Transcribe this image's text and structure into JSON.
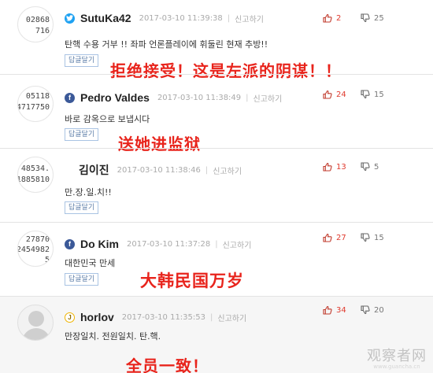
{
  "common": {
    "reply_label": "답글달기",
    "report_label": "신고하기",
    "separator": "|"
  },
  "comments": [
    {
      "avatar": [
        "02868",
        "716"
      ],
      "sns": "twitter",
      "sns_icon": "twitter-bird",
      "name": "SutuKa42",
      "time": "2017-03-10 11:39:38",
      "up": "2",
      "down": "25",
      "text": "탄핵 수용 거부 !! 좌파 언론플레이에 휘둘린 현재 추방!!",
      "caption": "拒绝接受！这是左派的阴谋！！"
    },
    {
      "avatar": [
        "05118",
        "4717750"
      ],
      "sns": "facebook",
      "sns_icon": "f",
      "name": "Pedro Valdes",
      "time": "2017-03-10 11:38:49",
      "up": "24",
      "down": "15",
      "text": "바로 감옥으로 보냅시다",
      "caption": "送她进监狱"
    },
    {
      "avatar": [
        "48534.",
        "1885810"
      ],
      "sns": "none",
      "sns_icon": "",
      "name": "김이진",
      "time": "2017-03-10 11:38:46",
      "up": "13",
      "down": "5",
      "text": "만.장.일.치!!",
      "caption": ""
    },
    {
      "avatar": [
        "27870",
        "2454982",
        "5"
      ],
      "sns": "facebook",
      "sns_icon": "f",
      "name": "Do Kim",
      "time": "2017-03-10 11:37:28",
      "up": "27",
      "down": "15",
      "text": "대한민국 만세",
      "caption": "大韩民国万岁"
    },
    {
      "avatar": [],
      "sns": "kakao",
      "sns_icon": "J",
      "name": "horlov",
      "time": "2017-03-10 11:35:53",
      "up": "34",
      "down": "20",
      "text": "만장일치. 전원일치. 탄.핵.",
      "caption": "全员一致！"
    }
  ],
  "watermark": {
    "main": "观察者网",
    "url": "www.guancha.cn"
  }
}
